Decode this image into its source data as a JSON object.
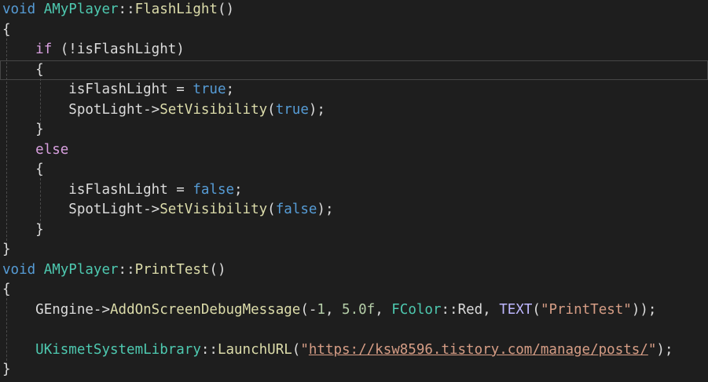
{
  "editor": {
    "language": "C++",
    "colors": {
      "background": "#1e1e1e",
      "text": "#dcdcdc",
      "keyword": "#569cd6",
      "control_keyword": "#d8a0df",
      "class_name": "#4ec9b0",
      "function_name": "#dcdcaa",
      "identifier": "#dcdcdc",
      "number": "#b5cea8",
      "string": "#d69d85",
      "macro": "#beb7ff",
      "current_line_border": "#464646",
      "indent_guide": "#4a4a4a"
    },
    "current_line_index": 3,
    "lines": [
      [
        {
          "t": "void",
          "c": "keyword"
        },
        {
          "t": " ",
          "c": "text"
        },
        {
          "t": "AMyPlayer",
          "c": "class_name"
        },
        {
          "t": "::",
          "c": "text"
        },
        {
          "t": "FlashLight",
          "c": "function_name"
        },
        {
          "t": "()",
          "c": "text"
        }
      ],
      [
        {
          "t": "{",
          "c": "text"
        }
      ],
      [
        {
          "t": "    ",
          "c": "text"
        },
        {
          "t": "if",
          "c": "control_keyword"
        },
        {
          "t": " (!",
          "c": "text"
        },
        {
          "t": "isFlashLight",
          "c": "identifier"
        },
        {
          "t": ")",
          "c": "text"
        }
      ],
      [
        {
          "t": "    {",
          "c": "text"
        }
      ],
      [
        {
          "t": "        ",
          "c": "text"
        },
        {
          "t": "isFlashLight",
          "c": "identifier"
        },
        {
          "t": " = ",
          "c": "text"
        },
        {
          "t": "true",
          "c": "keyword"
        },
        {
          "t": ";",
          "c": "text"
        }
      ],
      [
        {
          "t": "        ",
          "c": "text"
        },
        {
          "t": "SpotLight",
          "c": "identifier"
        },
        {
          "t": "->",
          "c": "text"
        },
        {
          "t": "SetVisibility",
          "c": "function_name"
        },
        {
          "t": "(",
          "c": "text"
        },
        {
          "t": "true",
          "c": "keyword"
        },
        {
          "t": ");",
          "c": "text"
        }
      ],
      [
        {
          "t": "    }",
          "c": "text"
        }
      ],
      [
        {
          "t": "    ",
          "c": "text"
        },
        {
          "t": "else",
          "c": "control_keyword"
        }
      ],
      [
        {
          "t": "    {",
          "c": "text"
        }
      ],
      [
        {
          "t": "        ",
          "c": "text"
        },
        {
          "t": "isFlashLight",
          "c": "identifier"
        },
        {
          "t": " = ",
          "c": "text"
        },
        {
          "t": "false",
          "c": "keyword"
        },
        {
          "t": ";",
          "c": "text"
        }
      ],
      [
        {
          "t": "        ",
          "c": "text"
        },
        {
          "t": "SpotLight",
          "c": "identifier"
        },
        {
          "t": "->",
          "c": "text"
        },
        {
          "t": "SetVisibility",
          "c": "function_name"
        },
        {
          "t": "(",
          "c": "text"
        },
        {
          "t": "false",
          "c": "keyword"
        },
        {
          "t": ");",
          "c": "text"
        }
      ],
      [
        {
          "t": "    }",
          "c": "text"
        }
      ],
      [
        {
          "t": "}",
          "c": "text"
        }
      ],
      [
        {
          "t": "void",
          "c": "keyword"
        },
        {
          "t": " ",
          "c": "text"
        },
        {
          "t": "AMyPlayer",
          "c": "class_name"
        },
        {
          "t": "::",
          "c": "text"
        },
        {
          "t": "PrintTest",
          "c": "function_name"
        },
        {
          "t": "()",
          "c": "text"
        }
      ],
      [
        {
          "t": "{",
          "c": "text"
        }
      ],
      [
        {
          "t": "    ",
          "c": "text"
        },
        {
          "t": "GEngine",
          "c": "identifier"
        },
        {
          "t": "->",
          "c": "text"
        },
        {
          "t": "AddOnScreenDebugMessage",
          "c": "function_name"
        },
        {
          "t": "(-",
          "c": "text"
        },
        {
          "t": "1",
          "c": "number"
        },
        {
          "t": ", ",
          "c": "text"
        },
        {
          "t": "5.0f",
          "c": "number"
        },
        {
          "t": ", ",
          "c": "text"
        },
        {
          "t": "FColor",
          "c": "class_name"
        },
        {
          "t": "::",
          "c": "text"
        },
        {
          "t": "Red",
          "c": "identifier"
        },
        {
          "t": ", ",
          "c": "text"
        },
        {
          "t": "TEXT",
          "c": "macro"
        },
        {
          "t": "(",
          "c": "text"
        },
        {
          "t": "\"PrintTest\"",
          "c": "string"
        },
        {
          "t": "));",
          "c": "text"
        }
      ],
      [
        {
          "t": "",
          "c": "text"
        }
      ],
      [
        {
          "t": "    ",
          "c": "text"
        },
        {
          "t": "UKismetSystemLibrary",
          "c": "class_name"
        },
        {
          "t": "::",
          "c": "text"
        },
        {
          "t": "LaunchURL",
          "c": "function_name"
        },
        {
          "t": "(",
          "c": "text"
        },
        {
          "t": "\"",
          "c": "string"
        },
        {
          "t": "https://ksw8596.tistory.com/manage/posts/",
          "c": "string",
          "link": true
        },
        {
          "t": "\"",
          "c": "string"
        },
        {
          "t": ");",
          "c": "text"
        }
      ],
      [
        {
          "t": "}",
          "c": "text"
        }
      ]
    ]
  }
}
